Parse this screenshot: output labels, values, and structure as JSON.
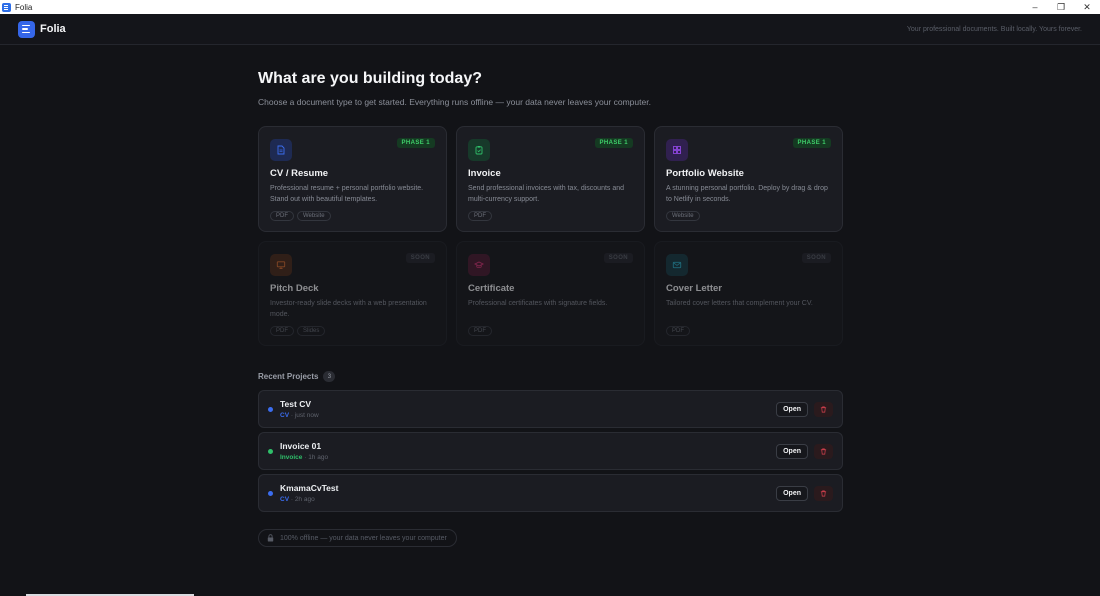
{
  "window": {
    "title": "Folia",
    "controls": [
      "–",
      "❐",
      "✕"
    ]
  },
  "header": {
    "app_name": "Folia",
    "tagline": "Your professional documents. Built locally. Yours forever."
  },
  "main": {
    "title": "What are you building today?",
    "subtitle": "Choose a document type to get started. Everything runs offline — your data never leaves your computer."
  },
  "cards": [
    {
      "title": "CV / Resume",
      "description": "Professional resume + personal portfolio website. Stand out with beautiful templates.",
      "badge": "PHASE 1",
      "tags": [
        "PDF",
        "Website"
      ],
      "icon": "document-icon",
      "accent": "#3b6df0"
    },
    {
      "title": "Invoice",
      "description": "Send professional invoices with tax, discounts and multi-currency support.",
      "badge": "PHASE 1",
      "tags": [
        "PDF"
      ],
      "icon": "clipboard-icon",
      "accent": "#2fbf6a"
    },
    {
      "title": "Portfolio Website",
      "description": "A stunning personal portfolio. Deploy by drag & drop to Netlify in seconds.",
      "badge": "PHASE 1",
      "tags": [
        "Website"
      ],
      "icon": "grid-icon",
      "accent": "#9a4cf0"
    },
    {
      "title": "Pitch Deck",
      "description": "Investor-ready slide decks with a web presentation mode.",
      "badge": "SOON",
      "tags": [
        "PDF",
        "Slides"
      ],
      "icon": "monitor-icon",
      "accent": "#e0702f"
    },
    {
      "title": "Certificate",
      "description": "Professional certificates with signature fields.",
      "badge": "SOON",
      "tags": [
        "PDF"
      ],
      "icon": "graduation-cap-icon",
      "accent": "#e0347a"
    },
    {
      "title": "Cover Letter",
      "description": "Tailored cover letters that complement your CV.",
      "badge": "SOON",
      "tags": [
        "PDF"
      ],
      "icon": "mail-icon",
      "accent": "#2ab0c8"
    }
  ],
  "recent": {
    "title": "Recent Projects",
    "count": "3",
    "projects": [
      {
        "name": "Test CV",
        "type": "CV",
        "time": "· just now",
        "color": "#3b6df0",
        "open_label": "Open"
      },
      {
        "name": "Invoice 01",
        "type": "Invoice",
        "time": "· 1h ago",
        "color": "#2fbf6a",
        "open_label": "Open"
      },
      {
        "name": "KmamaCvTest",
        "type": "CV",
        "time": "· 2h ago",
        "color": "#3b6df0",
        "open_label": "Open"
      }
    ]
  },
  "footer": {
    "offline_text": "100% offline — your data never leaves your computer"
  }
}
